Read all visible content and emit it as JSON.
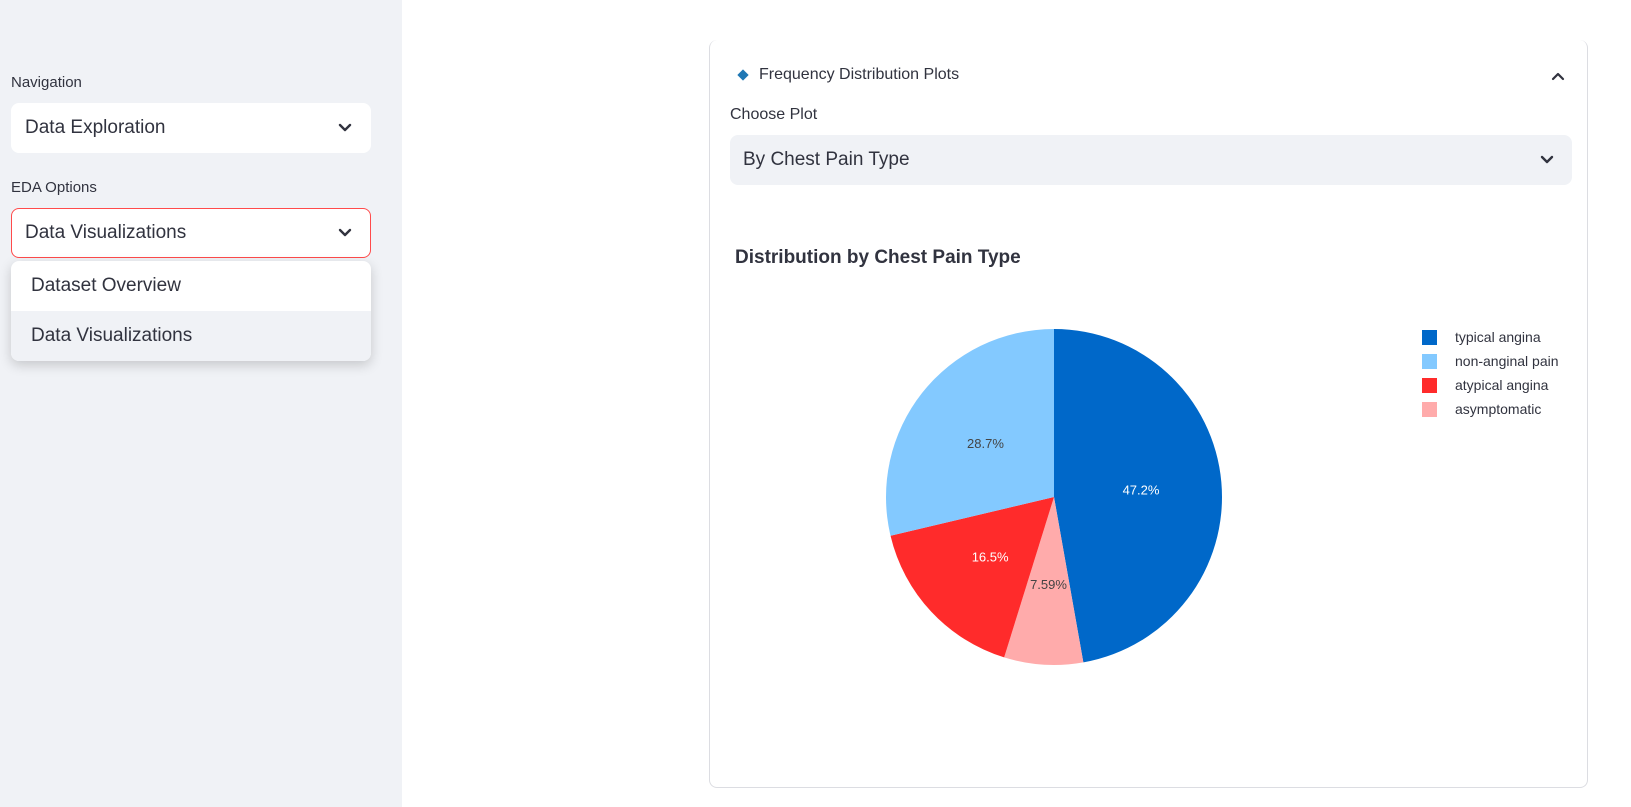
{
  "sidebar": {
    "navigation_label": "Navigation",
    "navigation_value": "Data Exploration",
    "eda_label": "EDA Options",
    "eda_value": "Data Visualizations",
    "eda_options": [
      "Dataset Overview",
      "Data Visualizations"
    ]
  },
  "panel": {
    "title": "Frequency Distribution Plots",
    "choose_label": "Choose Plot",
    "choose_value": "By Chest Pain Type"
  },
  "chart_data": {
    "type": "pie",
    "title": "Distribution by Chest Pain Type",
    "series": [
      {
        "name": "typical angina",
        "value": 47.2,
        "label": "47.2%",
        "color": "#0068c9"
      },
      {
        "name": "asymptomatic",
        "value": 7.59,
        "label": "7.59%",
        "color": "#ffabab"
      },
      {
        "name": "atypical angina",
        "value": 16.5,
        "label": "16.5%",
        "color": "#ff2b2b"
      },
      {
        "name": "non-anginal pain",
        "value": 28.7,
        "label": "28.7%",
        "color": "#83c9ff"
      }
    ],
    "legend": [
      "typical angina",
      "non-anginal pain",
      "atypical angina",
      "asymptomatic"
    ],
    "legend_placement": "top-right"
  },
  "colors": {
    "accent": "#ff4b4b",
    "sidebar_bg": "#f0f2f6"
  }
}
